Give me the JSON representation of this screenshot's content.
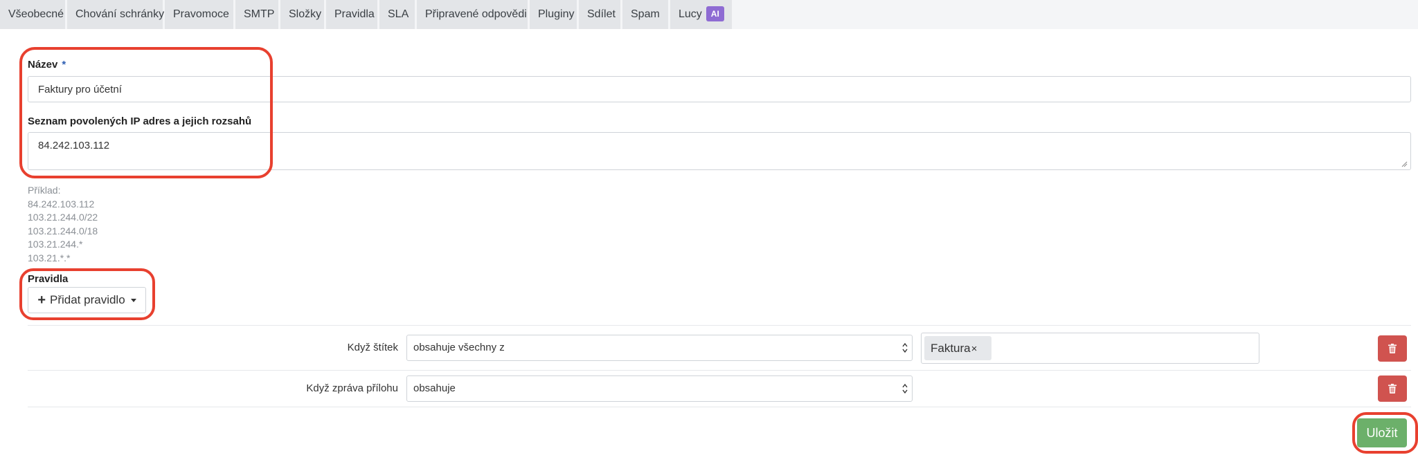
{
  "tabs": [
    {
      "label": "Všeobecné"
    },
    {
      "label": "Chování schránky"
    },
    {
      "label": "Pravomoce"
    },
    {
      "label": "SMTP"
    },
    {
      "label": "Složky"
    },
    {
      "label": "Pravidla"
    },
    {
      "label": "SLA"
    },
    {
      "label": "Připravené odpovědi"
    },
    {
      "label": "Pluginy"
    },
    {
      "label": "Sdílet"
    },
    {
      "label": "Spam"
    },
    {
      "label": "Lucy",
      "badge": "AI"
    }
  ],
  "form": {
    "name_label": "Název",
    "required_mark": "*",
    "name_value": "Faktury pro účetní",
    "ip_label": "Seznam povolených IP adres a jejich rozsahů",
    "ip_value": "84.242.103.112",
    "help_title": "Příklad:",
    "help_examples": [
      "84.242.103.112",
      "103.21.244.0/22",
      "103.21.244.0/18",
      "103.21.244.*",
      "103.21.*.*"
    ],
    "rules_label": "Pravidla",
    "add_rule_label": "Přidat pravidlo",
    "save_label": "Uložit"
  },
  "rules": [
    {
      "label": "Když štítek",
      "operator": "obsahuje všechny z",
      "tags": [
        {
          "text": "Faktura",
          "remove": "×"
        }
      ]
    },
    {
      "label": "Když zpráva přílohu",
      "operator": "obsahuje"
    }
  ],
  "colors": {
    "delete": "#d0534f",
    "save": "#6cb06a",
    "ai_badge": "#8e6bd3",
    "highlight": "#e8402f"
  }
}
